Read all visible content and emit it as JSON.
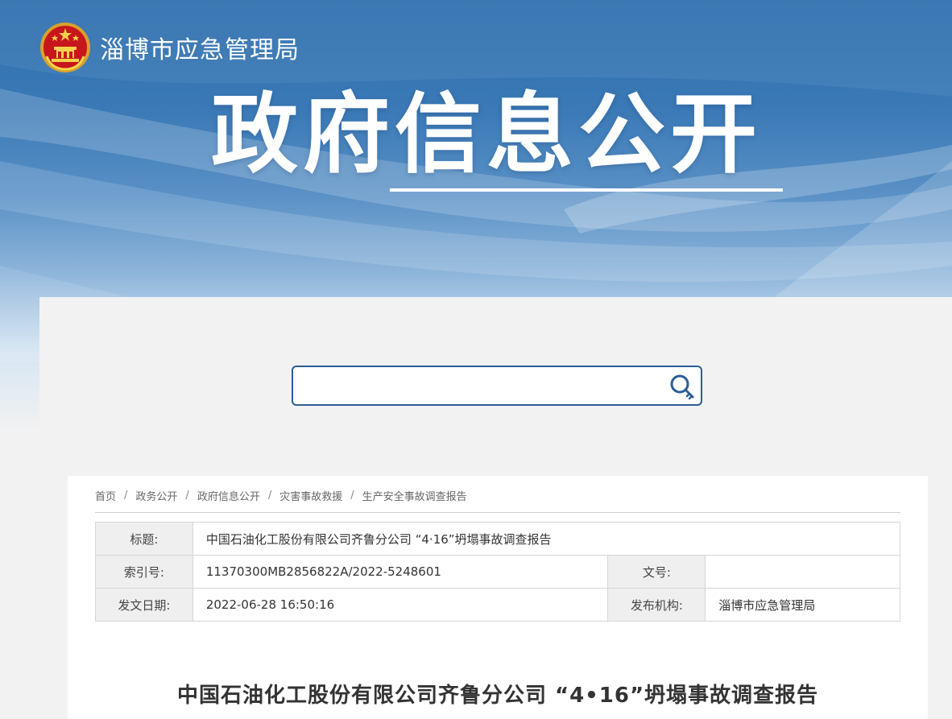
{
  "header": {
    "site_name": "淄博市应急管理局",
    "banner_title": "政府信息公开"
  },
  "search": {
    "value": "",
    "placeholder": "",
    "icon": "search-key-icon"
  },
  "breadcrumb": [
    "首页",
    "政务公开",
    "政府信息公开",
    "灾害事故救援",
    "生产安全事故调查报告"
  ],
  "meta": {
    "title_label": "标题:",
    "title_value": "中国石油化工股份有限公司齐鲁分公司 “4·16”坍塌事故调查报告",
    "index_label": "索引号:",
    "index_value": "11370300MB2856822A/2022-5248601",
    "docno_label": "文号:",
    "docno_value": "",
    "date_label": "发文日期:",
    "date_value": "2022-06-28 16:50:16",
    "org_label": "发布机构:",
    "org_value": "淄博市应急管理局"
  },
  "document": {
    "title": "中国石油化工股份有限公司齐鲁分公司 “4•16”坍塌事故调查报告"
  },
  "colors": {
    "brand_blue": "#2f6fae",
    "search_border": "#2a5d98"
  }
}
